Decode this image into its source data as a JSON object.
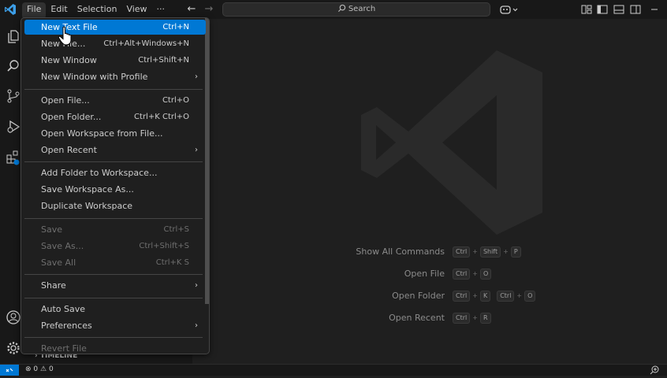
{
  "menubar": {
    "items": [
      "File",
      "Edit",
      "Selection",
      "View",
      "···"
    ],
    "active": "File"
  },
  "search": {
    "label": "Search"
  },
  "sidebar": {
    "timeline": "TIMELINE"
  },
  "file_menu": {
    "items": [
      {
        "label": "New Text File",
        "shortcut": "Ctrl+N",
        "highlight": true
      },
      {
        "label": "New File...",
        "shortcut": "Ctrl+Alt+Windows+N"
      },
      {
        "label": "New Window",
        "shortcut": "Ctrl+Shift+N"
      },
      {
        "label": "New Window with Profile",
        "submenu": true
      },
      {
        "label": "Open File...",
        "shortcut": "Ctrl+O"
      },
      {
        "label": "Open Folder...",
        "shortcut": "Ctrl+K Ctrl+O"
      },
      {
        "label": "Open Workspace from File..."
      },
      {
        "label": "Open Recent",
        "submenu": true
      },
      {
        "label": "Add Folder to Workspace..."
      },
      {
        "label": "Save Workspace As..."
      },
      {
        "label": "Duplicate Workspace"
      },
      {
        "label": "Save",
        "shortcut": "Ctrl+S",
        "disabled": true
      },
      {
        "label": "Save As...",
        "shortcut": "Ctrl+Shift+S",
        "disabled": true
      },
      {
        "label": "Save All",
        "shortcut": "Ctrl+K S",
        "disabled": true
      },
      {
        "label": "Share",
        "submenu": true
      },
      {
        "label": "Auto Save"
      },
      {
        "label": "Preferences",
        "submenu": true
      },
      {
        "label": "Revert File",
        "disabled": true
      }
    ]
  },
  "welcome_shortcuts": [
    {
      "label": "Show All Commands",
      "keys": [
        "Ctrl",
        "+",
        "Shift",
        "+",
        "P"
      ]
    },
    {
      "label": "Open File",
      "keys": [
        "Ctrl",
        "+",
        "O"
      ]
    },
    {
      "label": "Open Folder",
      "keys": [
        "Ctrl",
        "+",
        "K",
        "Ctrl",
        "+",
        "O"
      ]
    },
    {
      "label": "Open Recent",
      "keys": [
        "Ctrl",
        "+",
        "R"
      ]
    }
  ],
  "statusbar": {
    "errors": "0",
    "warnings": "0"
  },
  "colors": {
    "accent": "#0078d4",
    "background": "#1f1f1f",
    "chrome": "#181818"
  }
}
